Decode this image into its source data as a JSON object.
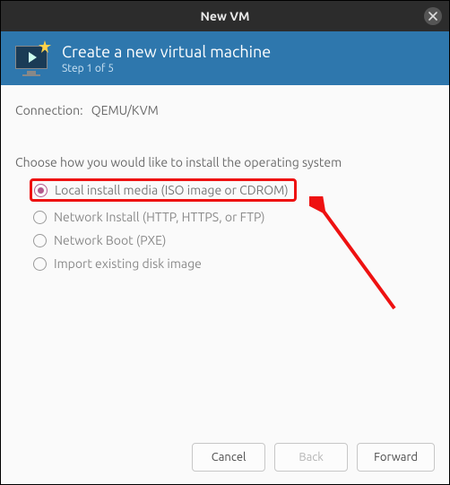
{
  "window": {
    "title": "New VM"
  },
  "header": {
    "title": "Create a new virtual machine",
    "step": "Step 1 of 5"
  },
  "connection": {
    "label": "Connection:",
    "value": "QEMU/KVM"
  },
  "prompt": "Choose how you would like to install the operating system",
  "options": [
    {
      "label": "Local install media (ISO image or CDROM)",
      "selected": true
    },
    {
      "label": "Network Install (HTTP, HTTPS, or FTP)",
      "selected": false
    },
    {
      "label": "Network Boot (PXE)",
      "selected": false
    },
    {
      "label": "Import existing disk image",
      "selected": false
    }
  ],
  "buttons": {
    "cancel": "Cancel",
    "back": "Back",
    "forward": "Forward"
  }
}
